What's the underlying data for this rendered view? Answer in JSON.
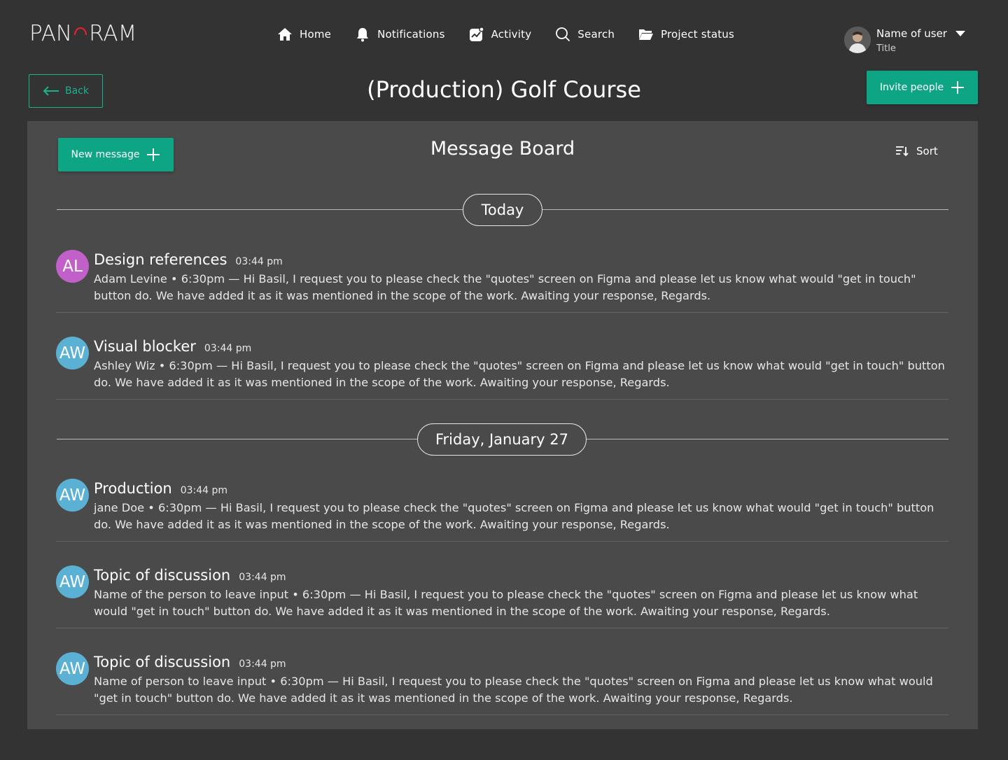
{
  "header": {
    "logo_left": "PAN",
    "logo_right": "RAM",
    "nav": [
      {
        "label": "Home",
        "icon": "home-icon"
      },
      {
        "label": "Notifications",
        "icon": "bell-icon"
      },
      {
        "label": "Activity",
        "icon": "activity-icon"
      },
      {
        "label": "Search",
        "icon": "search-icon"
      },
      {
        "label": "Project status",
        "icon": "folder-icon"
      }
    ],
    "user": {
      "name": "Name of user",
      "title": "Title"
    }
  },
  "toolbar": {
    "back_label": "Back",
    "page_title": "(Production) Golf Course",
    "invite_label": "Invite people"
  },
  "board": {
    "new_message_label": "New message",
    "title": "Message Board",
    "sort_label": "Sort",
    "groups": [
      {
        "date": "Today",
        "messages": [
          {
            "initials": "AL",
            "avatar_color": "#c060c8",
            "subject": "Design references",
            "time": "03:44 pm",
            "body": "Adam Levine • 6:30pm — Hi Basil, I request you to please check the \"quotes\" screen on Figma and please let us know what would \"get in touch\" button do. We have added it as it was mentioned in the scope of the work. Awaiting your response, Regards."
          },
          {
            "initials": "AW",
            "avatar_color": "#5bb1d3",
            "subject": "Visual blocker",
            "time": "03:44 pm",
            "body": "Ashley Wiz • 6:30pm — Hi Basil, I request you to please check the \"quotes\" screen on Figma and please let us know what would \"get in touch\" button do. We have added it as it was mentioned in the scope of the work. Awaiting your response, Regards."
          }
        ]
      },
      {
        "date": "Friday, January 27",
        "messages": [
          {
            "initials": "AW",
            "avatar_color": "#5bb1d3",
            "subject": "Production",
            "time": "03:44 pm",
            "body": "jane Doe • 6:30pm — Hi Basil, I request you to please check the \"quotes\" screen on Figma and please let us know what would \"get in touch\" button do. We have added it as it was mentioned in the scope of the work. Awaiting your response, Regards."
          },
          {
            "initials": "AW",
            "avatar_color": "#5bb1d3",
            "subject": "Topic of discussion",
            "time": "03:44 pm",
            "body": "Name of the person to leave input • 6:30pm — Hi Basil, I request you to please check the \"quotes\" screen on Figma and please let us know what would \"get in touch\" button do. We have added it as it was mentioned in the scope of the work. Awaiting your response, Regards."
          },
          {
            "initials": "AW",
            "avatar_color": "#5bb1d3",
            "subject": "Topic of discussion",
            "time": "03:44 pm",
            "body": "Name of person to leave input • 6:30pm — Hi Basil, I request you to please check the \"quotes\" screen on Figma and please let us know what would \"get in touch\" button do. We have added it as it was mentioned in the scope of the work. Awaiting your response, Regards."
          }
        ]
      }
    ]
  },
  "colors": {
    "accent": "#0ea585",
    "background": "#333333",
    "panel": "#4a4a4a",
    "logo_accent": "#e0222c"
  }
}
